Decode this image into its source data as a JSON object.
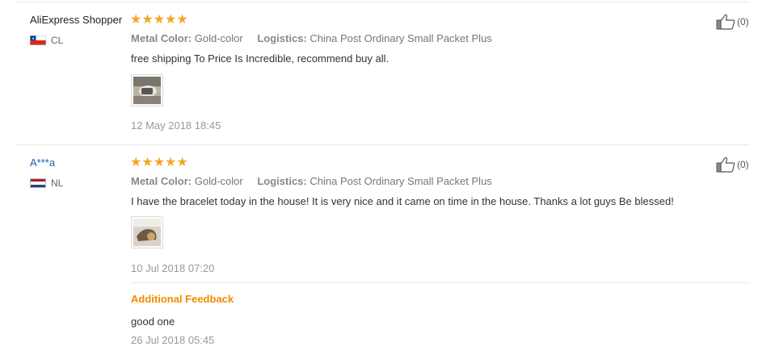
{
  "reviews": [
    {
      "user": "AliExpress Shopper",
      "country": "CL",
      "stars": "★★★★★",
      "rating": 5,
      "metal_label": "Metal Color:",
      "metal_value": "Gold-color",
      "logistics_label": "Logistics:",
      "logistics_value": "China Post Ordinary Small Packet Plus",
      "text": "free shipping To Price Is Incredible, recommend buy all.",
      "date": "12 May 2018 18:45",
      "helpful_count": "(0)"
    },
    {
      "user": "A***a",
      "country": "NL",
      "stars": "★★★★★",
      "rating": 5,
      "metal_label": "Metal Color:",
      "metal_value": "Gold-color",
      "logistics_label": "Logistics:",
      "logistics_value": "China Post Ordinary Small Packet Plus",
      "text": "I have the bracelet today in the house! It is very nice and it came on time in the house. Thanks a lot guys Be blessed!",
      "date": "10 Jul 2018 07:20",
      "helpful_count": "(0)",
      "additional": {
        "label": "Additional Feedback",
        "text": "good one",
        "date": "26 Jul 2018 05:45"
      }
    }
  ],
  "colors": {
    "star": "#f5a623",
    "additional_label": "#f08c00",
    "link": "#1a5fb4"
  }
}
